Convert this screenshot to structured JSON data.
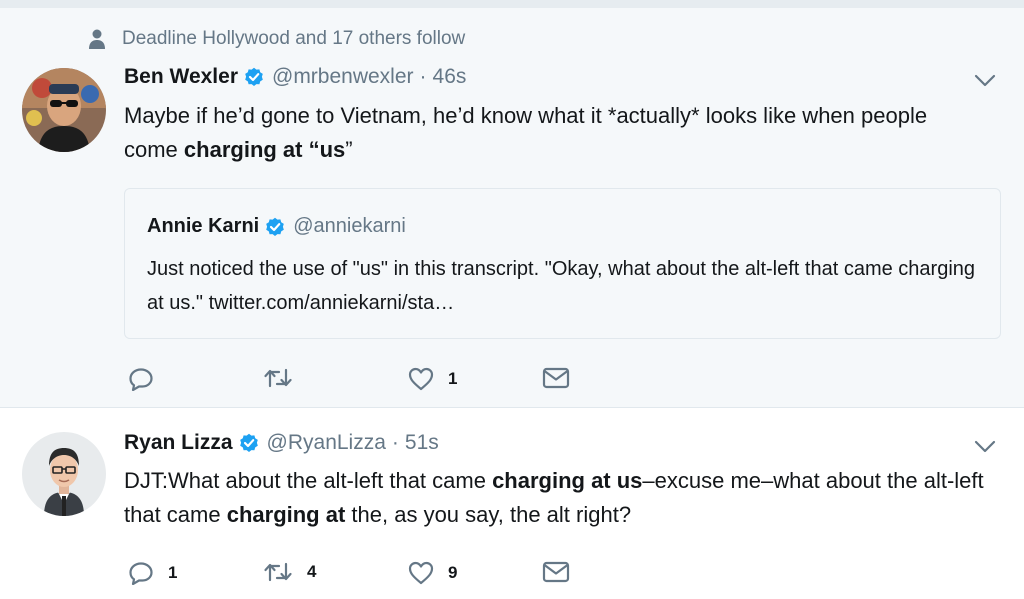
{
  "tweets": [
    {
      "social_context": "Deadline Hollywood and 17 others follow",
      "name": "Ben Wexler",
      "handle": "@mrbenwexler",
      "separator": "·",
      "time": "46s",
      "text_parts": {
        "p1": "Maybe if he’d gone to Vietnam, he’d know what it *actually* looks like when people come ",
        "b1": "charging at “us",
        "p2": "”"
      },
      "quote": {
        "name": "Annie Karni",
        "handle": "@anniekarni",
        "text": "Just noticed the use of \"us\" in this transcript. \"Okay, what about the alt-left that came charging at us.\" twitter.com/anniekarni/sta…"
      },
      "actions": {
        "reply_count": "",
        "retweet_count": "",
        "like_count": "1"
      }
    },
    {
      "name": "Ryan Lizza",
      "handle": "@RyanLizza",
      "separator": "·",
      "time": "51s",
      "text_parts": {
        "p1": "DJT:What about the alt-left that came ",
        "b1": "charging at us",
        "p2": "–excuse me–what about the alt-left that came ",
        "b2": "charging at",
        "p3": " the, as you say, the alt right?"
      },
      "actions": {
        "reply_count": "1",
        "retweet_count": "4",
        "like_count": "9"
      }
    }
  ],
  "icons": {
    "person": "person-icon",
    "verified": "verified-badge-icon",
    "chevron": "chevron-down-icon",
    "reply": "reply-icon",
    "retweet": "retweet-icon",
    "like": "heart-icon",
    "dm": "envelope-icon"
  },
  "colors": {
    "verified_blue": "#1da1f2",
    "secondary_text": "#657786",
    "primary_text": "#14171a",
    "highlight_bg": "#f5f8fa"
  }
}
